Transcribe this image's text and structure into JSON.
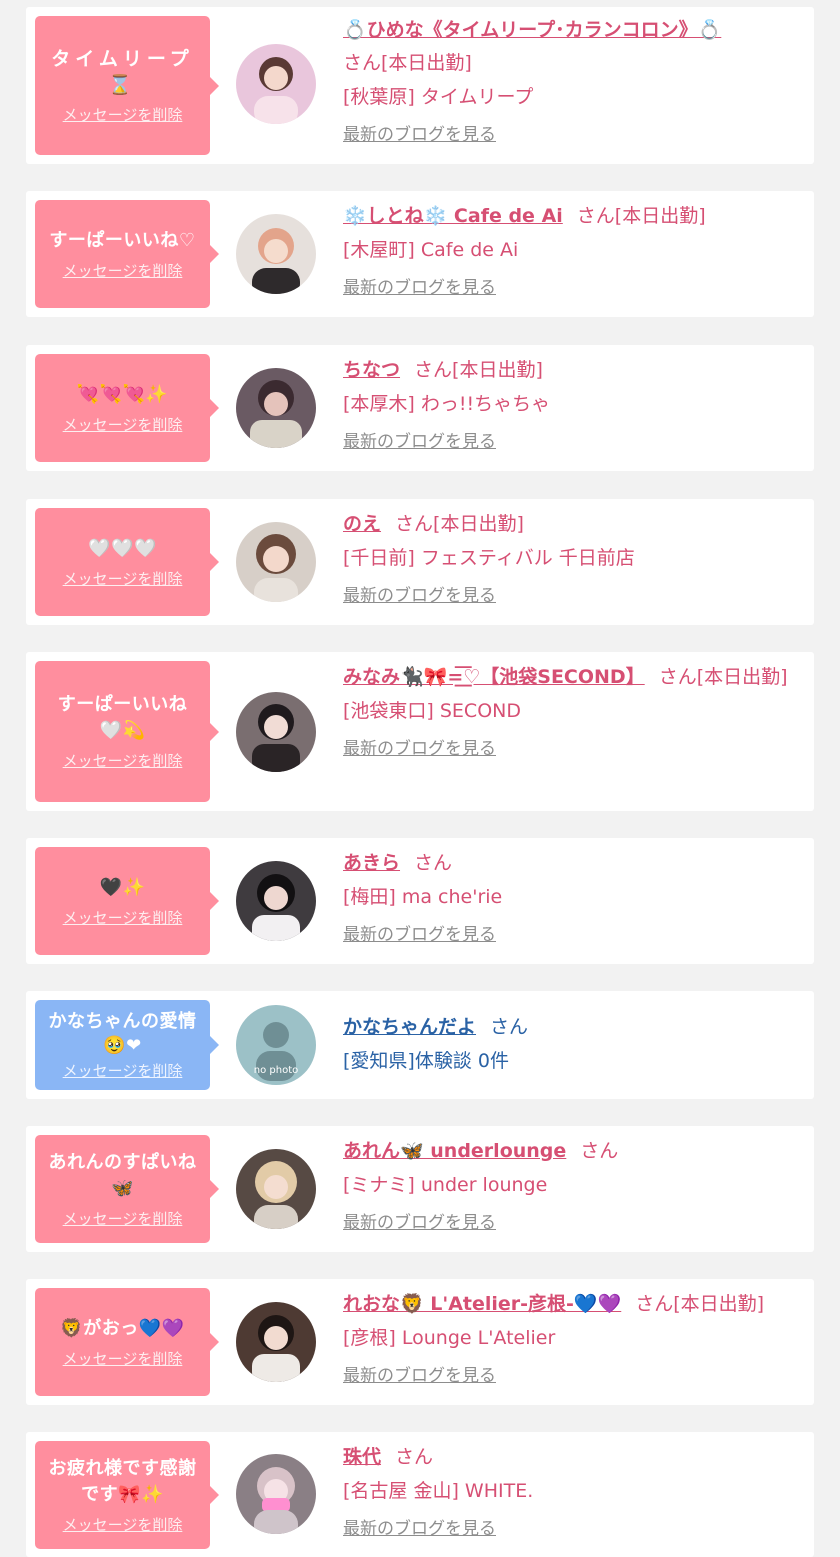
{
  "delete_label": "メッセージを削除",
  "san": "さん",
  "blog_label": "最新のブログを見る",
  "colors": {
    "pink_bubble": "#ff8e9e",
    "blue_bubble": "#8ab6f5",
    "name_pink": "#d64f73",
    "name_blue": "#2a62a5"
  },
  "items": [
    {
      "message": "タイムリープ⌛",
      "name": "💍ひめな《タイムリープ･カランコロン》💍",
      "suffix": "[本日出勤]",
      "shop": "[秋葉原] タイムリープ"
    },
    {
      "message": "すーぱーいいね♡",
      "name": "❄️しとね❄️ Cafe de Ai",
      "suffix": "[本日出勤]",
      "shop": "[木屋町] Cafe de Ai"
    },
    {
      "message": "💘💘💘✨",
      "name": "ちなつ",
      "suffix": "[本日出勤]",
      "shop": "[本厚木] わっ!!ちゃちゃ"
    },
    {
      "message": "🤍🤍🤍",
      "name": "のえ",
      "suffix": "[本日出勤]",
      "shop": "[千日前] フェスティバル 千日前店"
    },
    {
      "message": "すーぱーいいね🤍💫",
      "name": "みなみ🐈‍⬛🎀=͟͟͞♡【池袋SECOND】",
      "suffix": "[本日出勤]",
      "shop": "[池袋東口] SECOND"
    },
    {
      "message": "🖤✨",
      "name": "あきら",
      "suffix": "",
      "shop": "[梅田] ma che'rie"
    },
    {
      "message": "かなちゃんの愛情🥹❤",
      "name": "かなちゃんだよ",
      "suffix": "",
      "shop": "[愛知県]体験談 0件",
      "avatar_text": "no photo"
    },
    {
      "message": "あれんのすぱいね🦋",
      "name": "あれん🦋 underlounge",
      "suffix": "",
      "shop": "[ミナミ] under lounge"
    },
    {
      "message": "🦁がおっ💙💜",
      "name": "れおな🦁 L'Atelier-彦根-💙💜",
      "suffix": "[本日出勤]",
      "shop": "[彦根] Lounge L'Atelier"
    },
    {
      "message": "お疲れ様です感謝です🎀✨",
      "name": "珠代",
      "suffix": "",
      "shop": "[名古屋 金山] WHITE."
    }
  ]
}
